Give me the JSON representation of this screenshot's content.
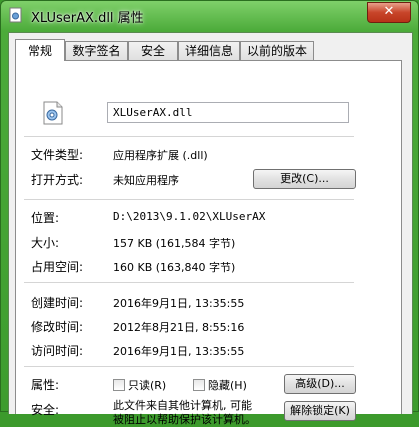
{
  "window": {
    "title": "XLUserAX.dll 属性",
    "close_glyph": "✕"
  },
  "tabs": [
    {
      "label": "常规"
    },
    {
      "label": "数字签名"
    },
    {
      "label": "安全"
    },
    {
      "label": "详细信息"
    },
    {
      "label": "以前的版本"
    }
  ],
  "general": {
    "filename": "XLUserAX.dll",
    "file_type_label": "文件类型:",
    "file_type_value": "应用程序扩展 (.dll)",
    "open_with_label": "打开方式:",
    "open_with_value": "未知应用程序",
    "change_button": "更改(C)...",
    "location_label": "位置:",
    "location_value": "D:\\2013\\9.1.02\\XLUserAX",
    "size_label": "大小:",
    "size_value": "157 KB (161,584 字节)",
    "size_on_disk_label": "占用空间:",
    "size_on_disk_value": "160 KB (163,840 字节)",
    "created_label": "创建时间:",
    "created_value": "2016年9月1日, 13:35:55",
    "modified_label": "修改时间:",
    "modified_value": "2012年8月21日, 8:55:16",
    "accessed_label": "访问时间:",
    "accessed_value": "2016年9月1日, 13:35:55",
    "attributes_label": "属性:",
    "readonly_label": "只读(R)",
    "hidden_label": "隐藏(H)",
    "advanced_button": "高级(D)...",
    "security_label": "安全:",
    "security_text_1": "此文件来自其他计算机, 可能",
    "security_text_2": "被阻止以帮助保护该计算机。",
    "unblock_button": "解除锁定(K)"
  }
}
